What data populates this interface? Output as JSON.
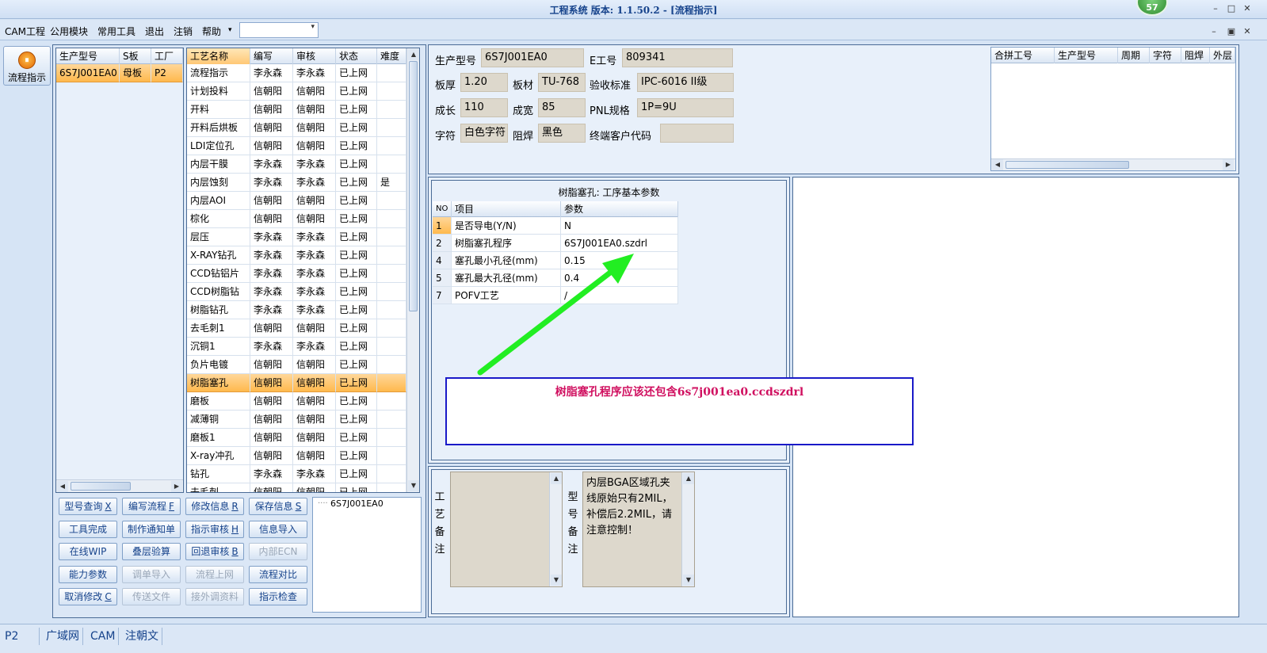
{
  "window": {
    "title": "工程系统   版本: 1.1.50.2 - [流程指示]",
    "badge": "57",
    "controls": [
      "–",
      "□",
      "✕"
    ]
  },
  "menu": {
    "items": [
      "CAM工程",
      "公用模块",
      "常用工具",
      "退出",
      "注销",
      "帮助"
    ],
    "help_arrow": "▾",
    "combo_value": "",
    "mdi_controls": [
      "–",
      "▣",
      "✕"
    ]
  },
  "nav": {
    "label": "流程指示",
    "icon": "process-icon"
  },
  "model_list": {
    "headers": [
      "生产型号",
      "S板",
      "工厂"
    ],
    "rows": [
      [
        "6S7J001EA0",
        "母板",
        "P2"
      ]
    ]
  },
  "process_list": {
    "headers": [
      "工艺名称",
      "编写",
      "审核",
      "状态",
      "难度"
    ],
    "rows": [
      [
        "流程指示",
        "李永森",
        "李永森",
        "已上网",
        ""
      ],
      [
        "计划投料",
        "信朝阳",
        "信朝阳",
        "已上网",
        ""
      ],
      [
        "开料",
        "信朝阳",
        "信朝阳",
        "已上网",
        ""
      ],
      [
        "开料后烘板",
        "信朝阳",
        "信朝阳",
        "已上网",
        ""
      ],
      [
        "LDI定位孔",
        "信朝阳",
        "信朝阳",
        "已上网",
        ""
      ],
      [
        "内层干膜",
        "李永森",
        "李永森",
        "已上网",
        ""
      ],
      [
        "内层蚀刻",
        "李永森",
        "李永森",
        "已上网",
        "是"
      ],
      [
        "内层AOI",
        "信朝阳",
        "信朝阳",
        "已上网",
        ""
      ],
      [
        "棕化",
        "信朝阳",
        "信朝阳",
        "已上网",
        ""
      ],
      [
        "层压",
        "李永森",
        "李永森",
        "已上网",
        ""
      ],
      [
        "X-RAY钻孔",
        "李永森",
        "李永森",
        "已上网",
        ""
      ],
      [
        "CCD钻铝片",
        "李永森",
        "李永森",
        "已上网",
        ""
      ],
      [
        "CCD树脂钻",
        "李永森",
        "李永森",
        "已上网",
        ""
      ],
      [
        "树脂钻孔",
        "李永森",
        "李永森",
        "已上网",
        ""
      ],
      [
        "去毛刺1",
        "信朝阳",
        "信朝阳",
        "已上网",
        ""
      ],
      [
        "沉铜1",
        "李永森",
        "李永森",
        "已上网",
        ""
      ],
      [
        "负片电镀",
        "信朝阳",
        "信朝阳",
        "已上网",
        ""
      ],
      [
        "树脂塞孔",
        "信朝阳",
        "信朝阳",
        "已上网",
        ""
      ],
      [
        "磨板",
        "信朝阳",
        "信朝阳",
        "已上网",
        ""
      ],
      [
        "减薄铜",
        "信朝阳",
        "信朝阳",
        "已上网",
        ""
      ],
      [
        "磨板1",
        "信朝阳",
        "信朝阳",
        "已上网",
        ""
      ],
      [
        "X-ray冲孔",
        "信朝阳",
        "信朝阳",
        "已上网",
        ""
      ],
      [
        "钻孔",
        "李永森",
        "李永森",
        "已上网",
        ""
      ],
      [
        "去毛刺",
        "信朝阳",
        "信朝阳",
        "已上网",
        ""
      ]
    ],
    "selected_index": 17
  },
  "buttons": [
    {
      "label": "型号查询",
      "key": "X",
      "enabled": true
    },
    {
      "label": "编写流程",
      "key": "F",
      "enabled": true
    },
    {
      "label": "修改信息",
      "key": "R",
      "enabled": true
    },
    {
      "label": "保存信息",
      "key": "S",
      "enabled": true
    },
    {
      "label": "工具完成",
      "key": "",
      "enabled": true
    },
    {
      "label": "制作通知单",
      "key": "",
      "enabled": true
    },
    {
      "label": "指示审核",
      "key": "H",
      "enabled": true
    },
    {
      "label": "信息导入",
      "key": "",
      "enabled": true
    },
    {
      "label": "在线WIP",
      "key": "",
      "enabled": true
    },
    {
      "label": "叠层验算",
      "key": "",
      "enabled": true
    },
    {
      "label": "回退审核",
      "key": "B",
      "enabled": true
    },
    {
      "label": "内部ECN",
      "key": "",
      "enabled": false
    },
    {
      "label": "能力参数",
      "key": "",
      "enabled": true
    },
    {
      "label": "调单导入",
      "key": "",
      "enabled": false
    },
    {
      "label": "流程上网",
      "key": "",
      "enabled": false
    },
    {
      "label": "流程对比",
      "key": "",
      "enabled": true
    },
    {
      "label": "取消修改",
      "key": "C",
      "enabled": true
    },
    {
      "label": "传送文件",
      "key": "",
      "enabled": false
    },
    {
      "label": "接外调资料",
      "key": "",
      "enabled": false
    },
    {
      "label": "指示检查",
      "key": "",
      "enabled": true
    }
  ],
  "tree": {
    "node": "6S7J001EA0"
  },
  "info": {
    "prod_model_label": "生产型号",
    "prod_model": "6S7J001EA0",
    "e_no_label": "E工号",
    "e_no": "809341",
    "thickness_label": "板厚",
    "thickness": "1.20",
    "material_label": "板材",
    "material": "TU-768",
    "standard_label": "验收标准",
    "standard": "IPC-6016 II级",
    "length_label": "成长",
    "length": "110",
    "width_label": "成宽",
    "width": "85",
    "pnl_label": "PNL规格",
    "pnl": "1P=9U",
    "char_label": "字符",
    "char": "白色字符",
    "mask_label": "阻焊",
    "mask": "黑色",
    "customer_label": "终端客户代码",
    "customer": ""
  },
  "combine_grid": {
    "headers": [
      "合拼工号",
      "生产型号",
      "周期",
      "字符",
      "阻焊",
      "外层"
    ]
  },
  "params": {
    "title": "树脂塞孔: 工序基本参数",
    "headers": [
      "NO",
      "项目",
      "参数"
    ],
    "rows": [
      [
        "1",
        "是否导电(Y/N)",
        "N"
      ],
      [
        "2",
        "树脂塞孔程序",
        "6S7J001EA0.szdrl"
      ],
      [
        "4",
        "塞孔最小孔径(mm)",
        "0.15"
      ],
      [
        "5",
        "塞孔最大孔径(mm)",
        "0.4"
      ],
      [
        "7",
        "POFV工艺",
        "/"
      ]
    ]
  },
  "annotation": {
    "text": "树脂塞孔程序应该还包含6s7j001ea0.ccdszdrl",
    "arrow_color": "#22ee22",
    "text_color": "#d01060"
  },
  "notes": {
    "process_label": [
      "工",
      "艺",
      "备",
      "注"
    ],
    "process_note": "",
    "model_label": [
      "型",
      "号",
      "备",
      "注"
    ],
    "model_note": "内层BGA区域孔夹线原始只有2MIL，补偿后2.2MIL，请注意控制！"
  },
  "status": {
    "factory": "P2",
    "factory_arrow": "▾",
    "items": [
      "广域网",
      "CAM",
      "注朝文"
    ]
  }
}
